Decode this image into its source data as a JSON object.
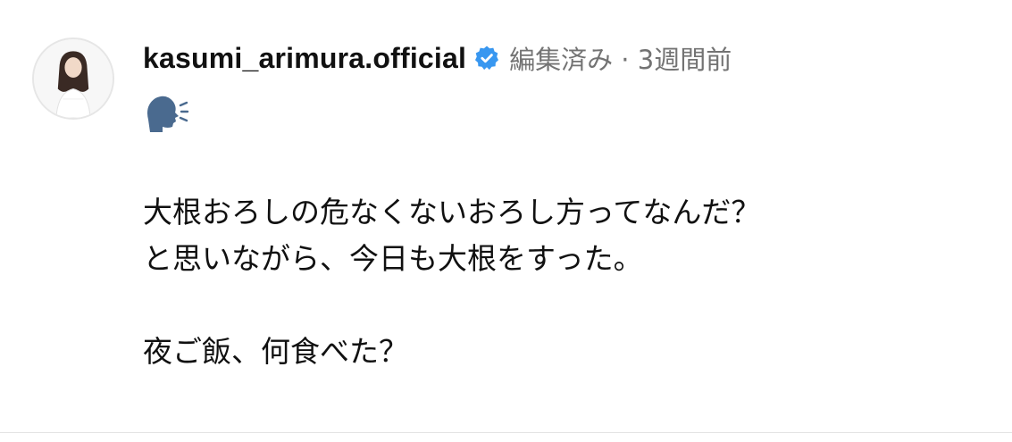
{
  "post": {
    "username": "kasumi_arimura.official",
    "verified": true,
    "verified_color": "#3897f0",
    "meta": "編集済み · 3週間前",
    "emoji_icon": "speaking-head-icon",
    "caption_lines": [
      "大根おろしの危なくないおろし方ってなんだ？",
      "と思いながら、今日も大根をすった。",
      "",
      "夜ご飯、何食べた？"
    ]
  }
}
